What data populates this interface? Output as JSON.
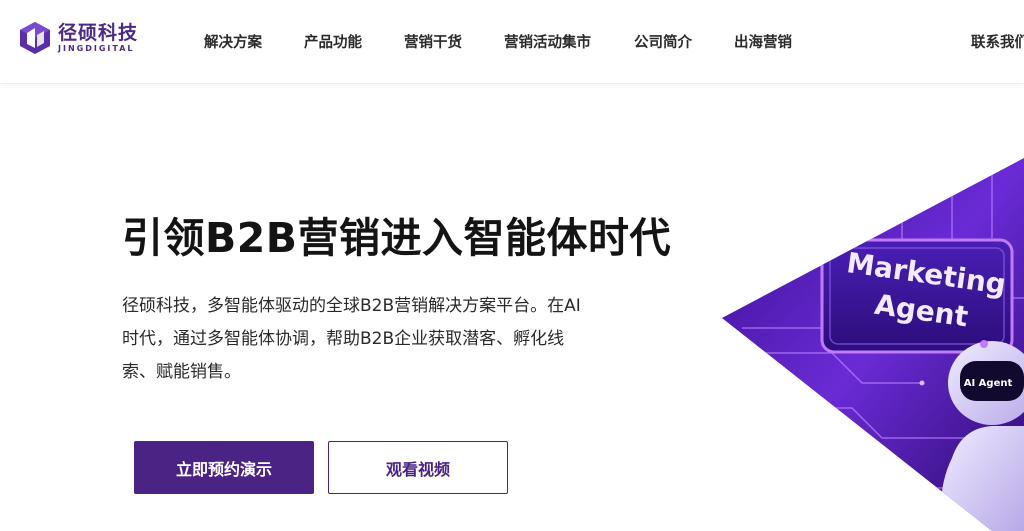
{
  "brand": {
    "name_cn": "径硕科技",
    "name_en": "JINGDIGITAL",
    "color": "#4b2a8a"
  },
  "nav": {
    "items": [
      {
        "label": "解决方案"
      },
      {
        "label": "产品功能"
      },
      {
        "label": "营销干货"
      },
      {
        "label": "营销活动集市"
      },
      {
        "label": "公司简介"
      },
      {
        "label": "出海营销"
      }
    ],
    "contact_label": "联系我们"
  },
  "hero": {
    "title": "引领B2B营销进入智能体时代",
    "description": "径硕科技，多智能体驱动的全球B2B营销解决方案平台。在AI时代，通过多智能体协调，帮助B2B企业获取潜客、孵化线索、赋能销售。",
    "primary_button": "立即预约演示",
    "secondary_button": "观看视频",
    "image": {
      "screen_text_line1": "Marketing",
      "screen_text_line2": "Agent",
      "robot_visor_text": "AI Agent"
    }
  },
  "colors": {
    "accent": "#4a2384",
    "art_purple": "#6a2bd6",
    "art_neon": "#c07bff"
  },
  "icons": {
    "logo": "jingdigital-logo-icon"
  }
}
